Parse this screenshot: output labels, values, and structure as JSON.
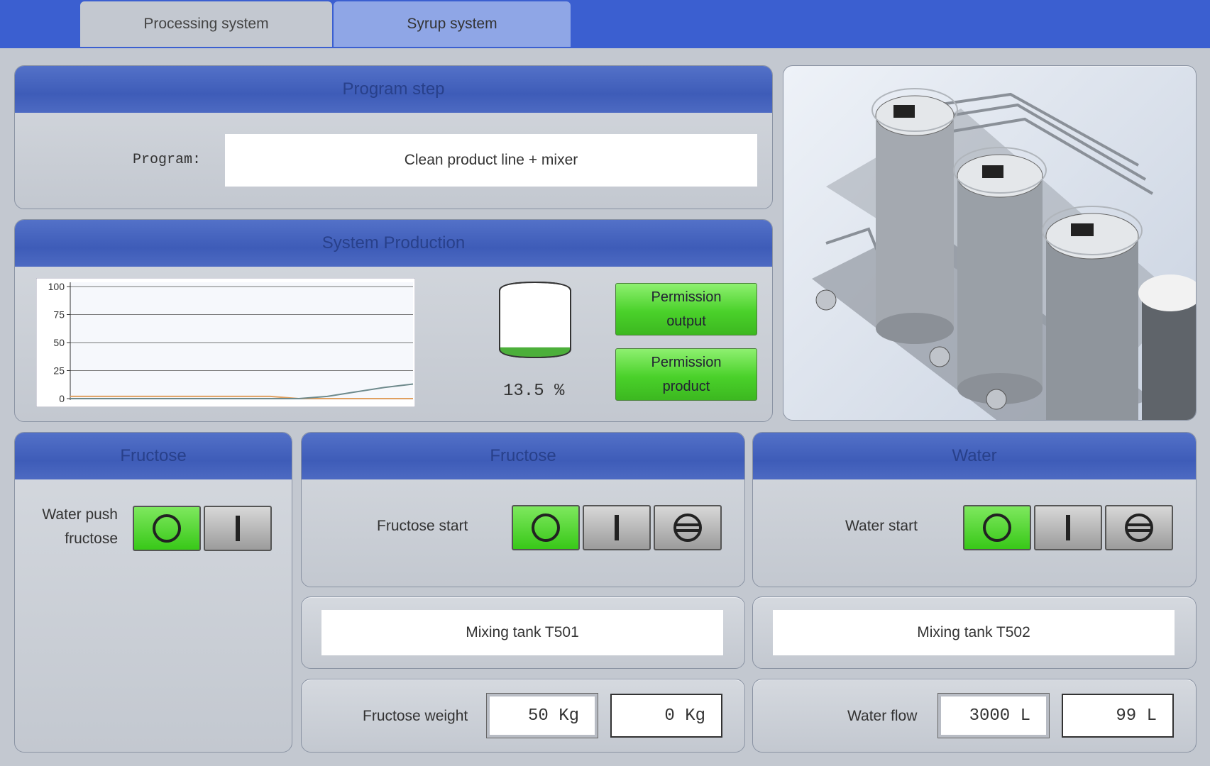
{
  "tabs": [
    {
      "label": "Processing system",
      "active": true
    },
    {
      "label": "Syrup system",
      "active": false
    }
  ],
  "program_step": {
    "title": "Program step",
    "program_label": "Program:",
    "program_value": "Clean product line + mixer"
  },
  "system_production": {
    "title": "System Production",
    "tank_level_text": "13.5 %",
    "tank_level_fraction": 0.135,
    "permission_output": [
      "Permission",
      "output"
    ],
    "permission_product": [
      "Permission",
      "product"
    ],
    "chart_data": {
      "type": "line",
      "yticks": [
        "100",
        "75",
        "50",
        "25",
        "0"
      ],
      "ylim": [
        0,
        100
      ],
      "grid": true,
      "series": [
        {
          "values": [
            2,
            2,
            2,
            2,
            2,
            2,
            2,
            2,
            0,
            0,
            0,
            0,
            0
          ],
          "color": "#e0a060"
        },
        {
          "values": [
            0,
            0,
            0,
            0,
            0,
            0,
            0,
            0,
            0,
            2,
            6,
            10,
            13
          ],
          "color": "#6e8a8c"
        }
      ]
    }
  },
  "fructose_left": {
    "title": "Fructose",
    "label_line1": "Water push",
    "label_line2": "fructose"
  },
  "fructose_mid": {
    "title": "Fructose",
    "start_label": "Fructose start",
    "tank": "Mixing tank T501",
    "weight_label": "Fructose weight",
    "weight_set": "50  Kg",
    "weight_actual": "0  Kg"
  },
  "water": {
    "title": "Water",
    "start_label": "Water start",
    "tank": "Mixing tank T502",
    "flow_label": "Water flow",
    "flow_set": "3000  L",
    "flow_actual": "99  L"
  }
}
